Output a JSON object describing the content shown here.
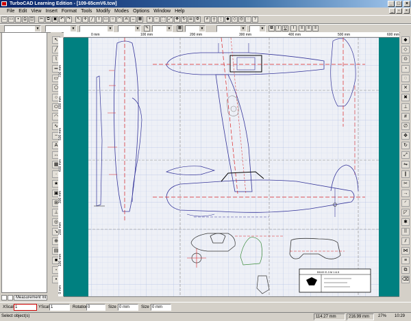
{
  "window": {
    "title": "TurboCAD Learning Edition - [109-65cmV6.tcw]"
  },
  "menu": {
    "items": [
      "File",
      "Edit",
      "View",
      "Insert",
      "Format",
      "Tools",
      "Modify",
      "Modes",
      "Options",
      "Window",
      "Help"
    ]
  },
  "rulers": {
    "top_labels": [
      "0 mm",
      "100 mm",
      "200 mm",
      "300 mm",
      "400 mm",
      "500 mm",
      "600 mm"
    ],
    "left_labels": [
      "700 mm",
      "600 mm",
      "500 mm",
      "400 mm",
      "300 mm",
      "200 mm",
      "100 mm",
      "0 mm"
    ]
  },
  "tabs": {
    "measurement": "Measurement lnl"
  },
  "inspector": {
    "xscale_label": "XScale",
    "xscale_value": "1",
    "yscale_label": "YScale",
    "yscale_value": "1",
    "rotation_label": "Rotation",
    "rotation_value": "0",
    "sizex_label": "Size X",
    "sizex_value": "0 mm",
    "sizey_label": "Size Y",
    "sizey_value": "0 mm"
  },
  "status": {
    "message": "Select object(s)",
    "coord_x": "114.27 mm",
    "coord_y": "216.99 mm",
    "zoom": "27%",
    "time": "10:29"
  },
  "drawing": {
    "title_block": "Bf109 E-3 M 1:6.5"
  },
  "colors": {
    "titlebar": "#0a246a",
    "canvas_border": "#008080",
    "outline": "#3333aa",
    "centerline": "#dd2222",
    "grid": "#b8c4e6"
  }
}
